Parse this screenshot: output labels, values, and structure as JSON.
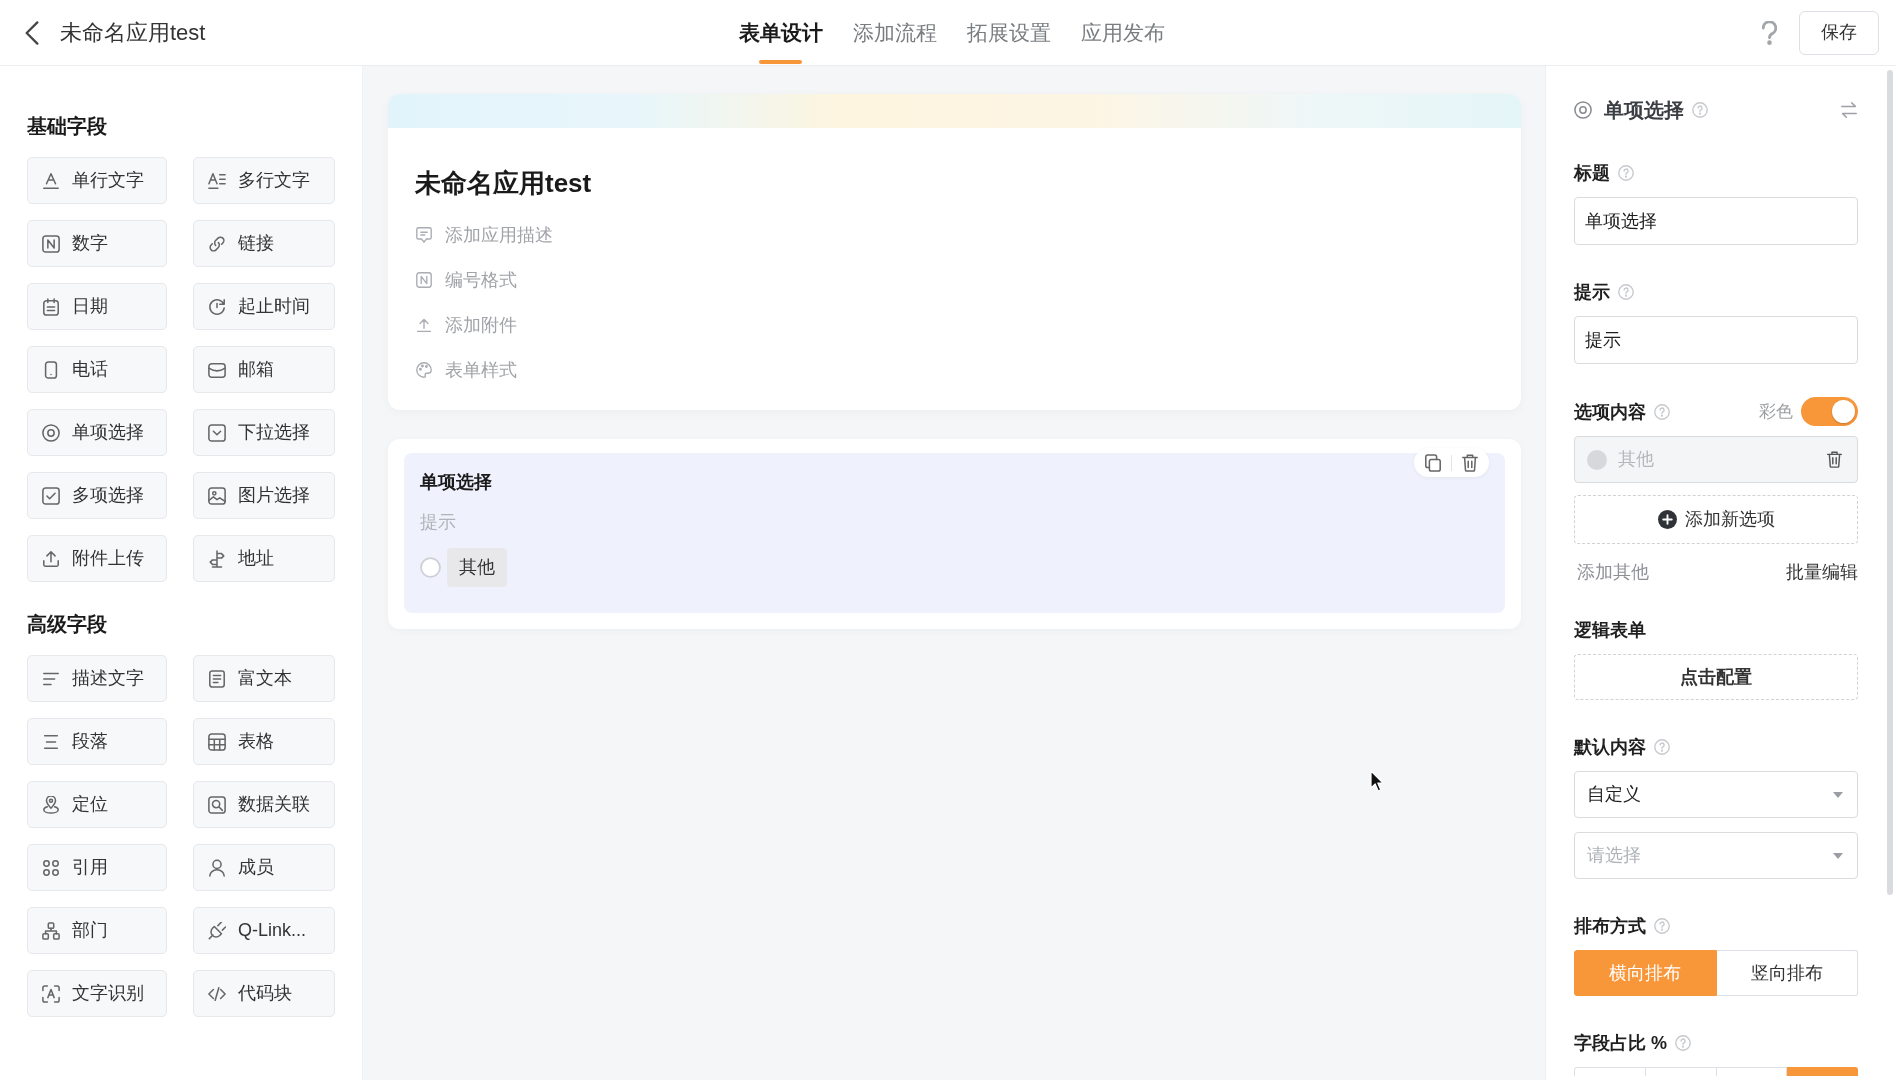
{
  "header": {
    "title": "未命名应用test",
    "tabs": [
      {
        "label": "表单设计",
        "selected": true
      },
      {
        "label": "添加流程",
        "selected": false
      },
      {
        "label": "拓展设置",
        "selected": false
      },
      {
        "label": "应用发布",
        "selected": false
      }
    ],
    "save_button": "保存"
  },
  "sidebar": {
    "sections": [
      {
        "title": "基础字段",
        "items": [
          {
            "label": "单行文字",
            "kind": "text"
          },
          {
            "label": "多行文字",
            "kind": "textarea"
          },
          {
            "label": "数字",
            "kind": "number"
          },
          {
            "label": "链接",
            "kind": "link"
          },
          {
            "label": "日期",
            "kind": "date"
          },
          {
            "label": "起止时间",
            "kind": "daterange"
          },
          {
            "label": "电话",
            "kind": "phone"
          },
          {
            "label": "邮箱",
            "kind": "email"
          },
          {
            "label": "单项选择",
            "kind": "radio"
          },
          {
            "label": "下拉选择",
            "kind": "select"
          },
          {
            "label": "多项选择",
            "kind": "checkbox"
          },
          {
            "label": "图片选择",
            "kind": "image"
          },
          {
            "label": "附件上传",
            "kind": "upload"
          },
          {
            "label": "地址",
            "kind": "address"
          }
        ]
      },
      {
        "title": "高级字段",
        "items": [
          {
            "label": "描述文字",
            "kind": "description"
          },
          {
            "label": "富文本",
            "kind": "richtext"
          },
          {
            "label": "段落",
            "kind": "paragraph"
          },
          {
            "label": "表格",
            "kind": "table"
          },
          {
            "label": "定位",
            "kind": "location"
          },
          {
            "label": "数据关联",
            "kind": "lookup"
          },
          {
            "label": "引用",
            "kind": "reference"
          },
          {
            "label": "成员",
            "kind": "member"
          },
          {
            "label": "部门",
            "kind": "department"
          },
          {
            "label": "Q-Link...",
            "kind": "plugin"
          },
          {
            "label": "文字识别",
            "kind": "ocr"
          },
          {
            "label": "代码块",
            "kind": "code"
          }
        ]
      }
    ]
  },
  "form": {
    "title": "未命名应用test",
    "actions": [
      {
        "label": "添加应用描述",
        "kind": "description"
      },
      {
        "label": "编号格式",
        "kind": "numbering"
      },
      {
        "label": "添加附件",
        "kind": "attachment"
      },
      {
        "label": "表单样式",
        "kind": "style"
      }
    ],
    "fields": [
      {
        "label": "单项选择",
        "hint": "提示",
        "selected": true,
        "options": [
          {
            "label": "其他",
            "selected": false
          }
        ]
      }
    ]
  },
  "properties": {
    "title": "单项选择",
    "help": true,
    "sections": [
      {
        "kind": "input",
        "label": "标题",
        "help": true,
        "value": "单项选择"
      },
      {
        "kind": "input",
        "label": "提示",
        "help": true,
        "value": "提示"
      },
      {
        "kind": "options",
        "label": "选项内容",
        "help": true,
        "color_label": "彩色",
        "color_on": true,
        "options": [
          {
            "label": "其他",
            "disabled": true
          }
        ],
        "add_button": "添加新选项",
        "add_other": "添加其他",
        "batch_edit": "批量编辑"
      },
      {
        "kind": "button",
        "label": "逻辑表单",
        "button": "点击配置"
      },
      {
        "kind": "selects",
        "label": "默认内容",
        "help": true,
        "selects": [
          {
            "value": "自定义"
          },
          {
            "placeholder": "请选择"
          }
        ]
      },
      {
        "kind": "segmented",
        "label": "排布方式",
        "help": true,
        "segments": [
          {
            "label": "横向排布",
            "selected": true
          },
          {
            "label": "竖向排布",
            "selected": false
          }
        ]
      },
      {
        "kind": "segmented",
        "label": "字段占比 %",
        "help": true,
        "segments": [
          {
            "selected": false
          },
          {
            "selected": false
          },
          {
            "selected": false
          },
          {
            "selected": true
          }
        ]
      }
    ]
  }
}
